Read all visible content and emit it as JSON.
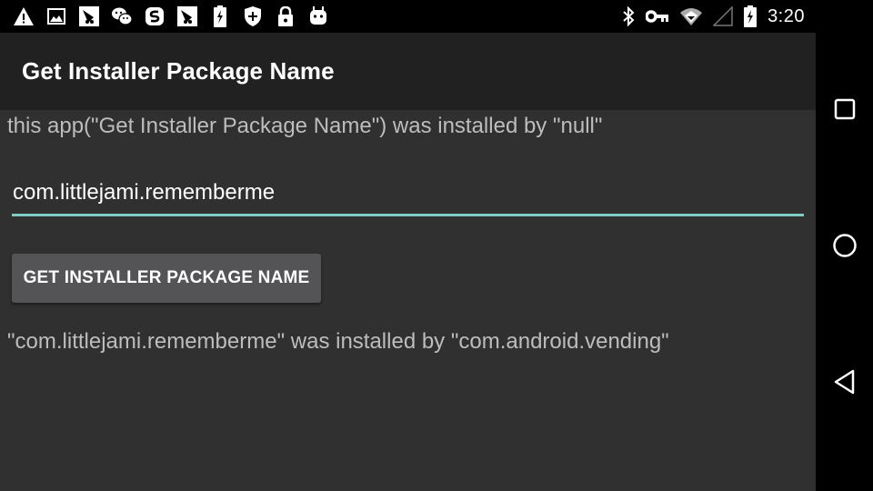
{
  "status_bar": {
    "left_icons": [
      {
        "name": "warning-icon"
      },
      {
        "name": "image-icon"
      },
      {
        "name": "app-notification-icon"
      },
      {
        "name": "wechat-icon"
      },
      {
        "name": "sogou-icon"
      },
      {
        "name": "app-notification-icon-2"
      },
      {
        "name": "battery-saver-icon"
      },
      {
        "name": "shield-plus-icon"
      },
      {
        "name": "lock-icon"
      },
      {
        "name": "android-icon"
      }
    ],
    "right_icons": [
      {
        "name": "bluetooth-icon"
      },
      {
        "name": "vpn-key-icon"
      },
      {
        "name": "wifi-icon"
      },
      {
        "name": "cell-signal-icon"
      },
      {
        "name": "battery-charging-icon"
      }
    ],
    "time": "3:20"
  },
  "toolbar": {
    "title": "Get Installer Package Name"
  },
  "main": {
    "info_text": "this app(\"Get Installer Package Name\") was installed by \"null\"",
    "package_input": {
      "value": "com.littlejami.rememberme",
      "placeholder": ""
    },
    "button_label": "GET INSTALLER PACKAGE NAME",
    "result_text": "\"com.littlejami.rememberme\" was installed by \"com.android.vending\""
  },
  "nav_bar": {
    "buttons": [
      {
        "name": "recents-button",
        "icon": "square-icon"
      },
      {
        "name": "home-button",
        "icon": "circle-icon"
      },
      {
        "name": "back-button",
        "icon": "triangle-back-icon"
      }
    ]
  },
  "colors": {
    "accent": "#80cbc4",
    "toolbar_bg": "#212121",
    "content_bg": "#303030",
    "button_bg": "#545457",
    "secondary_text": "#bdbdbd"
  }
}
